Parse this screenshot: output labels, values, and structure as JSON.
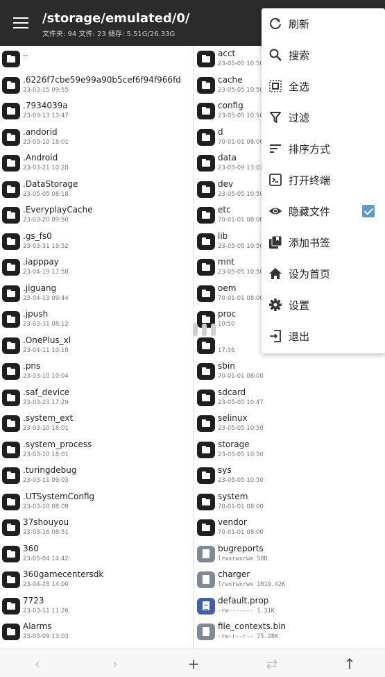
{
  "appbar": {
    "title": "/storage/emulated/0/",
    "subtitle": "文件夹: 94  文件: 23  储存: 5.51G/26.33G"
  },
  "left_files": [
    {
      "name": "..",
      "meta": "",
      "icon": "folder-icon"
    },
    {
      "name": ".6226f7cbe59e99a90b5cef6f94f966fd",
      "meta": "23-03-15 09:55",
      "icon": "folder-icon"
    },
    {
      "name": ".7934039a",
      "meta": "23-03-13 13:47",
      "icon": "folder-icon"
    },
    {
      "name": ".andorid",
      "meta": "23-03-10 18:01",
      "icon": "folder-icon"
    },
    {
      "name": ".Android",
      "meta": "23-03-21 10:28",
      "icon": "folder-icon"
    },
    {
      "name": ".DataStorage",
      "meta": "23-05-05 08:18",
      "icon": "folder-icon"
    },
    {
      "name": ".EveryplayCache",
      "meta": "23-03-20 09:50",
      "icon": "folder-icon"
    },
    {
      "name": ".gs_fs0",
      "meta": "23-03-31 19:52",
      "icon": "folder-icon"
    },
    {
      "name": ".iapppay",
      "meta": "23-04-19 17:58",
      "icon": "folder-icon"
    },
    {
      "name": ".jiguang",
      "meta": "23-04-13 09:44",
      "icon": "folder-icon"
    },
    {
      "name": ".jpush",
      "meta": "23-03-31 08:12",
      "icon": "folder-icon"
    },
    {
      "name": ".OnePlus_xl",
      "meta": "23-04-11 10:19",
      "icon": "folder-icon"
    },
    {
      "name": ".pns",
      "meta": "23-03-10 10:04",
      "icon": "folder-icon"
    },
    {
      "name": ".saf_device",
      "meta": "23-03-23 17:29",
      "icon": "folder-icon"
    },
    {
      "name": ".system_ext",
      "meta": "23-03-10 18:01",
      "icon": "folder-icon"
    },
    {
      "name": ".system_process",
      "meta": "23-03-10 18:01",
      "icon": "folder-icon"
    },
    {
      "name": ".turingdebug",
      "meta": "23-03-11 09:03",
      "icon": "folder-icon"
    },
    {
      "name": ".UTSystemConfig",
      "meta": "23-03-10 08:09",
      "icon": "folder-icon"
    },
    {
      "name": "37shouyou",
      "meta": "23-03-16 08:51",
      "icon": "folder-icon"
    },
    {
      "name": "360",
      "meta": "23-05-04 14:42",
      "icon": "folder-icon"
    },
    {
      "name": "360gamecentersdk",
      "meta": "23-04-28 14:00",
      "icon": "folder-icon"
    },
    {
      "name": "7723",
      "meta": "23-03-11 11:26",
      "icon": "folder-icon"
    },
    {
      "name": "Alarms",
      "meta": "23-03-09 13:03",
      "icon": "folder-icon"
    }
  ],
  "right_files": [
    {
      "name": "acct",
      "meta": "23-05-05 10:50",
      "icon": "folder-icon"
    },
    {
      "name": "cache",
      "meta": "23-05-05 10:50",
      "icon": "folder-icon"
    },
    {
      "name": "config",
      "meta": "23-05-05 10:50",
      "icon": "folder-icon"
    },
    {
      "name": "d",
      "meta": "70-01-01 08:00",
      "icon": "folder-icon"
    },
    {
      "name": "data",
      "meta": "23-03-09 13:03",
      "icon": "folder-icon"
    },
    {
      "name": "dev",
      "meta": "23-05-05 10:50",
      "icon": "folder-icon"
    },
    {
      "name": "etc",
      "meta": "70-01-01 08:00",
      "icon": "folder-icon"
    },
    {
      "name": "lib",
      "meta": "23-05-05 10:50",
      "icon": "folder-icon"
    },
    {
      "name": "mnt",
      "meta": "23-05-05 10:50",
      "icon": "folder-icon"
    },
    {
      "name": "oem",
      "meta": "70-01-01 08:00",
      "icon": "folder-icon"
    },
    {
      "name": "proc",
      "meta": "10:50",
      "icon": "folder-icon"
    },
    {
      "name": "",
      "meta": "17:36",
      "icon": "folder-icon"
    },
    {
      "name": "sbin",
      "meta": "70-01-01 08:00",
      "icon": "folder-icon"
    },
    {
      "name": "sdcard",
      "meta": "23-05-05 10:47",
      "icon": "folder-icon"
    },
    {
      "name": "selinux",
      "meta": "23-05-05 10:50",
      "icon": "folder-icon"
    },
    {
      "name": "storage",
      "meta": "23-05-05 10:50",
      "icon": "folder-icon"
    },
    {
      "name": "sys",
      "meta": "23-05-05 10:50",
      "icon": "folder-icon"
    },
    {
      "name": "system",
      "meta": "70-01-01 08:00",
      "icon": "folder-icon"
    },
    {
      "name": "vendor",
      "meta": "70-01-01 08:00",
      "icon": "folder-icon"
    },
    {
      "name": "bugreports",
      "meta": "lrwxrwxrwx  50B",
      "icon": "file-icon"
    },
    {
      "name": "charger",
      "meta": "lrwxrwxrwx  1019.42K",
      "icon": "file-icon"
    },
    {
      "name": "default.prop",
      "meta": "-rw-------  1.31K",
      "icon": "document-icon"
    },
    {
      "name": "file_contexts.bin",
      "meta": "-rw-r--r--  75.28K",
      "icon": "file-icon"
    }
  ],
  "menu": {
    "refresh": "刷新",
    "search": "搜索",
    "select_all": "全选",
    "filter": "过滤",
    "sort": "排序方式",
    "terminal": "打开终端",
    "hidden_files": "隐藏文件",
    "bookmark": "添加书签",
    "set_home": "设为首页",
    "settings": "设置",
    "exit": "退出"
  },
  "bottom": {
    "back": "‹",
    "forward": "›",
    "add": "+",
    "swap": "⇄",
    "up": "↑"
  }
}
